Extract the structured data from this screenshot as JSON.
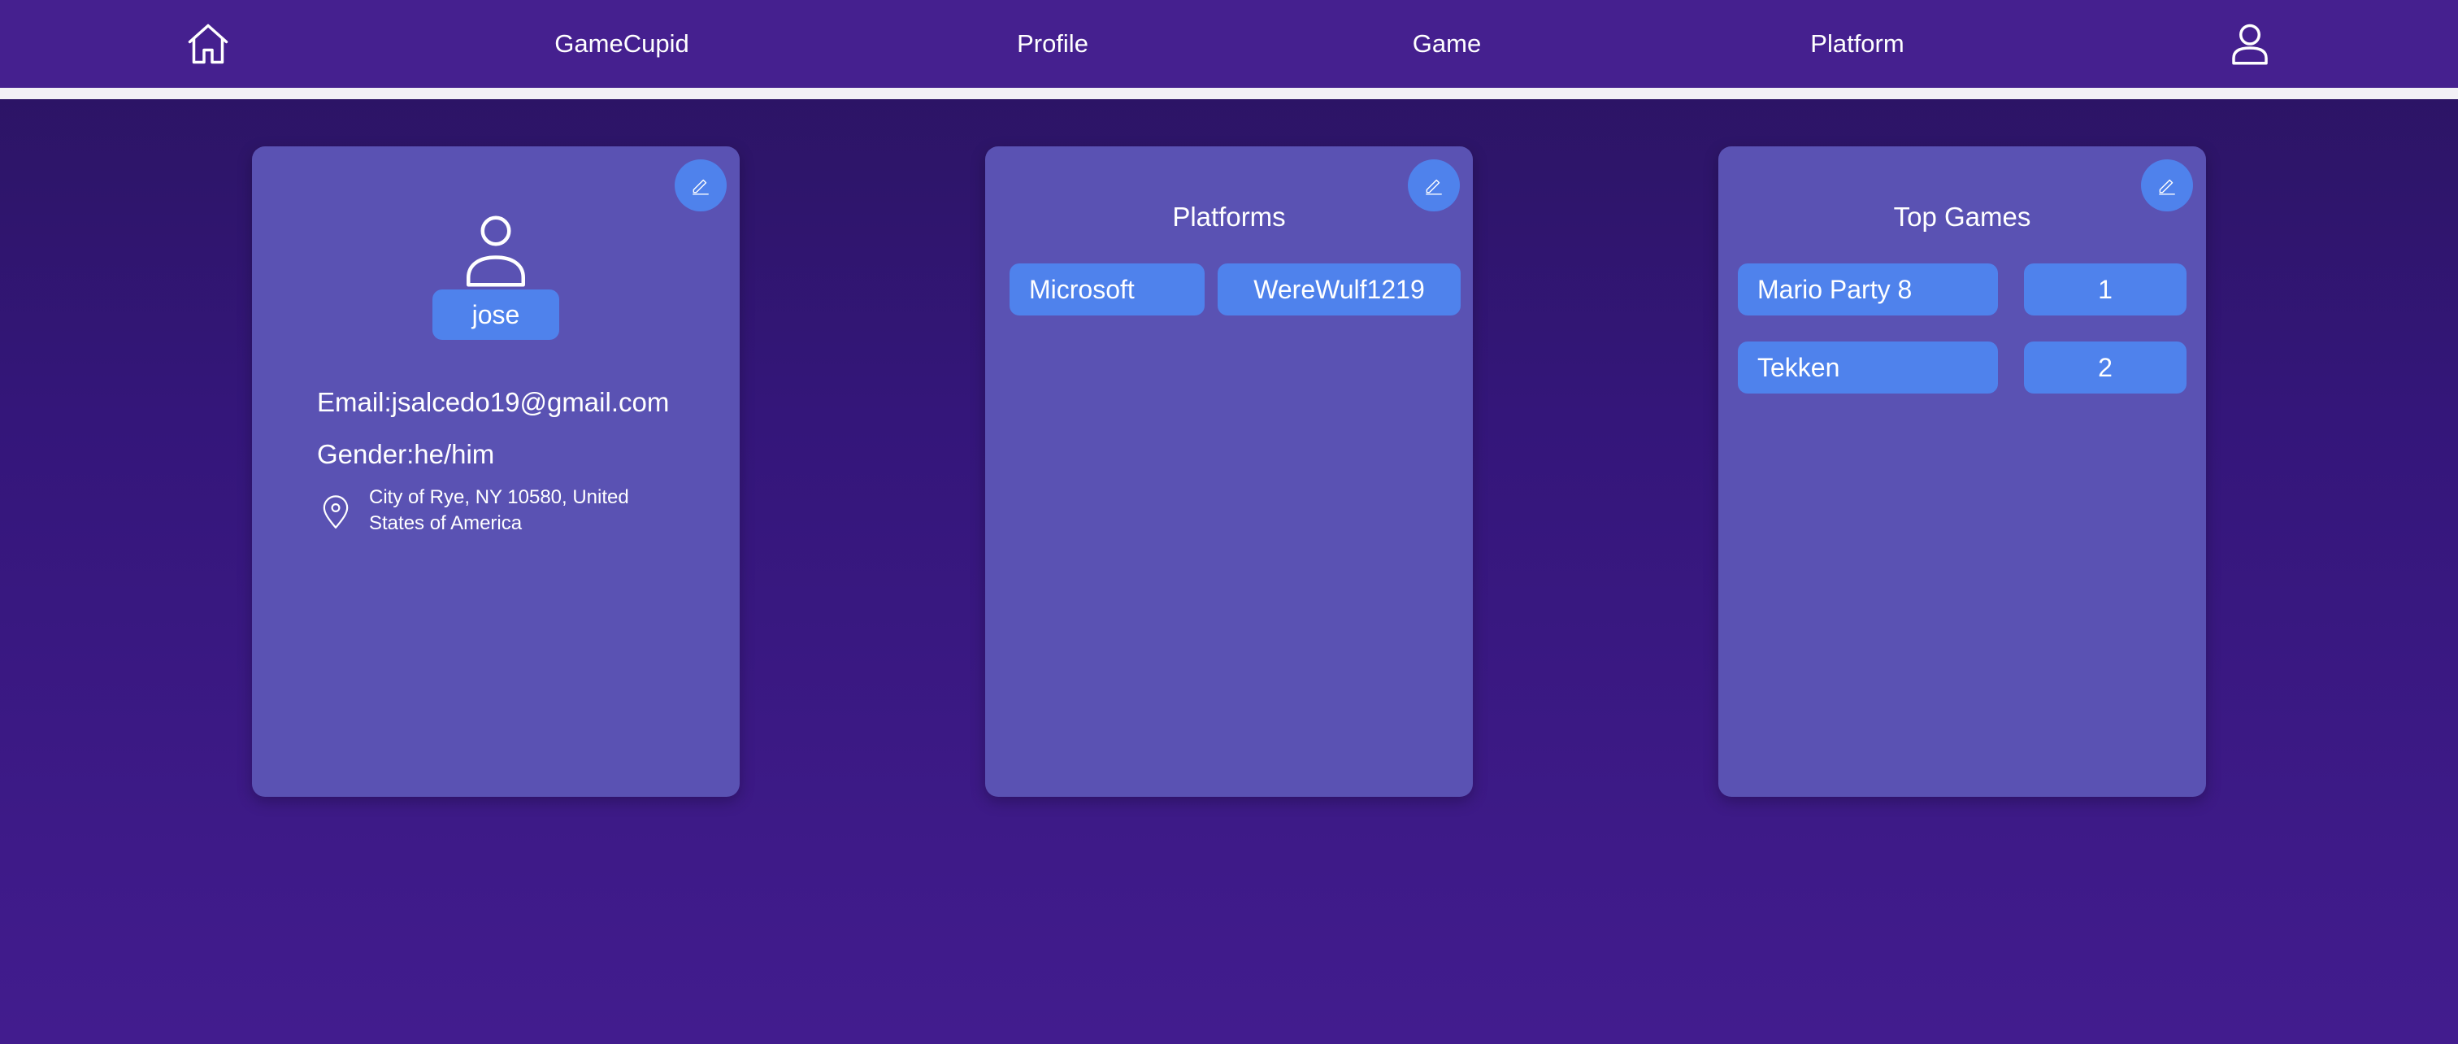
{
  "nav": {
    "home_icon": "home-icon",
    "brand": "GameCupid",
    "profile": "Profile",
    "game": "Game",
    "platform": "Platform",
    "account_icon": "user-icon"
  },
  "profile_card": {
    "edit_icon": "pencil-icon",
    "avatar_icon": "user-icon",
    "username": "jose",
    "email": "Email:jsalcedo19@gmail.com",
    "gender": "Gender:he/him",
    "location_icon": "map-pin-icon",
    "location": "City of Rye, NY 10580, United States of America"
  },
  "platforms_card": {
    "edit_icon": "pencil-icon",
    "title": "Platforms",
    "items": [
      {
        "platform": "Microsoft",
        "handle": "WereWulf1219"
      }
    ]
  },
  "games_card": {
    "edit_icon": "pencil-icon",
    "title": "Top Games",
    "items": [
      {
        "name": "Mario Party 8",
        "rank": "1"
      },
      {
        "name": "Tekken",
        "rank": "2"
      }
    ]
  },
  "colors": {
    "navbar": "#45208f",
    "card": "#5a52b3",
    "accent": "#4f82ec",
    "background_top": "#2a1460",
    "background_bottom": "#421c8e"
  }
}
